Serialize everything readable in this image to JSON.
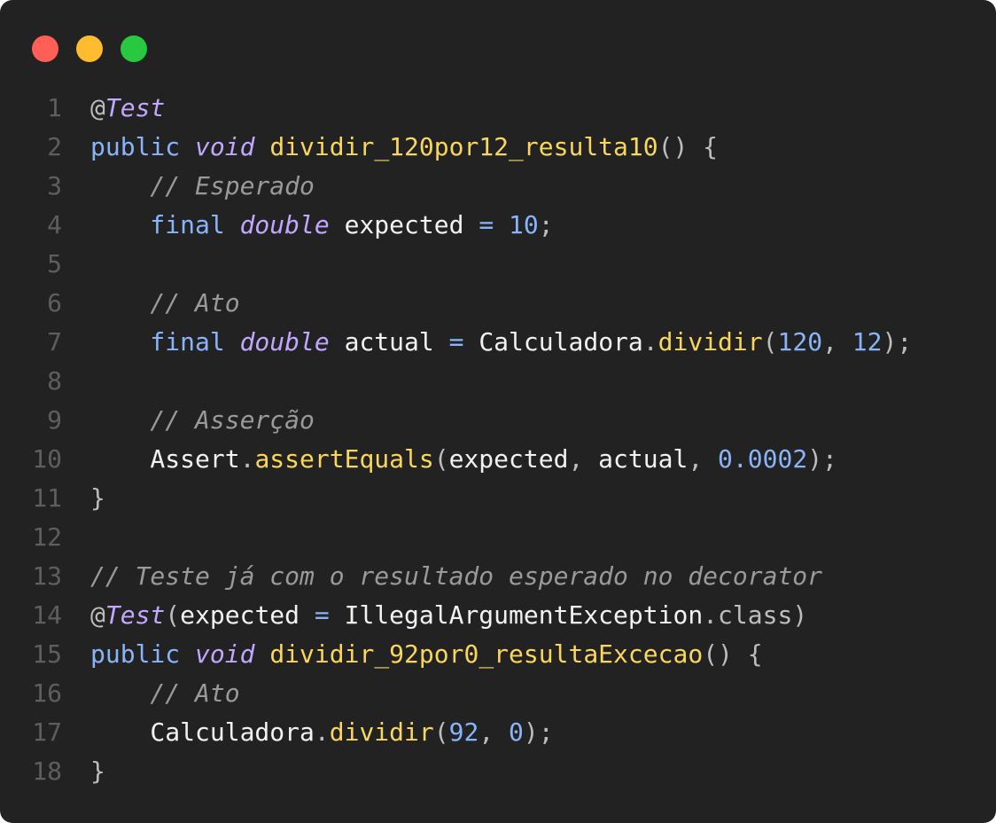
{
  "window": {
    "controls": [
      {
        "name": "close-dot",
        "color": "#ff5f57"
      },
      {
        "name": "minimize-dot",
        "color": "#febc2e"
      },
      {
        "name": "maximize-dot",
        "color": "#28c840"
      }
    ]
  },
  "colors": {
    "background": "#222222",
    "line_number": "#5e5e5e",
    "keyword": "#89b4fa",
    "type_italic": "#c3a6ff",
    "method": "#f9d65c",
    "identifier": "#f2f2f2",
    "number": "#89b4fa",
    "comment": "#9a9a9a",
    "punct": "#bdbdbd",
    "operator": "#89b4fa"
  },
  "code": {
    "lines": [
      {
        "n": "1",
        "tokens": [
          {
            "t": "@",
            "c": "punct"
          },
          {
            "t": "Test",
            "c": "type_italic",
            "i": true
          }
        ]
      },
      {
        "n": "2",
        "tokens": [
          {
            "t": "public ",
            "c": "keyword"
          },
          {
            "t": "void ",
            "c": "type_italic",
            "i": true
          },
          {
            "t": "dividir_120por12_resulta10",
            "c": "method"
          },
          {
            "t": "() {",
            "c": "punct"
          }
        ]
      },
      {
        "n": "3",
        "tokens": [
          {
            "t": "    // Esperado",
            "c": "comment",
            "i": true
          }
        ]
      },
      {
        "n": "4",
        "tokens": [
          {
            "t": "    final ",
            "c": "keyword"
          },
          {
            "t": "double ",
            "c": "type_italic",
            "i": true
          },
          {
            "t": "expected ",
            "c": "identifier"
          },
          {
            "t": "= ",
            "c": "operator"
          },
          {
            "t": "10",
            "c": "number"
          },
          {
            "t": ";",
            "c": "punct"
          }
        ]
      },
      {
        "n": "5",
        "tokens": []
      },
      {
        "n": "6",
        "tokens": [
          {
            "t": "    // Ato",
            "c": "comment",
            "i": true
          }
        ]
      },
      {
        "n": "7",
        "tokens": [
          {
            "t": "    final ",
            "c": "keyword"
          },
          {
            "t": "double ",
            "c": "type_italic",
            "i": true
          },
          {
            "t": "actual ",
            "c": "identifier"
          },
          {
            "t": "= ",
            "c": "operator"
          },
          {
            "t": "Calculadora",
            "c": "identifier"
          },
          {
            "t": ".",
            "c": "punct"
          },
          {
            "t": "dividir",
            "c": "method"
          },
          {
            "t": "(",
            "c": "punct"
          },
          {
            "t": "120",
            "c": "number"
          },
          {
            "t": ", ",
            "c": "punct"
          },
          {
            "t": "12",
            "c": "number"
          },
          {
            "t": ");",
            "c": "punct"
          }
        ]
      },
      {
        "n": "8",
        "tokens": []
      },
      {
        "n": "9",
        "tokens": [
          {
            "t": "    // Asserção",
            "c": "comment",
            "i": true
          }
        ]
      },
      {
        "n": "10",
        "tokens": [
          {
            "t": "    Assert",
            "c": "identifier"
          },
          {
            "t": ".",
            "c": "punct"
          },
          {
            "t": "assertEquals",
            "c": "method"
          },
          {
            "t": "(",
            "c": "punct"
          },
          {
            "t": "expected",
            "c": "identifier"
          },
          {
            "t": ", ",
            "c": "punct"
          },
          {
            "t": "actual",
            "c": "identifier"
          },
          {
            "t": ", ",
            "c": "punct"
          },
          {
            "t": "0.0002",
            "c": "number"
          },
          {
            "t": ");",
            "c": "punct"
          }
        ]
      },
      {
        "n": "11",
        "tokens": [
          {
            "t": "}",
            "c": "punct"
          }
        ]
      },
      {
        "n": "12",
        "tokens": []
      },
      {
        "n": "13",
        "tokens": [
          {
            "t": "// Teste já com o resultado esperado no decorator",
            "c": "comment",
            "i": true
          }
        ]
      },
      {
        "n": "14",
        "tokens": [
          {
            "t": "@",
            "c": "punct"
          },
          {
            "t": "Test",
            "c": "type_italic",
            "i": true
          },
          {
            "t": "(",
            "c": "punct"
          },
          {
            "t": "expected ",
            "c": "identifier"
          },
          {
            "t": "= ",
            "c": "operator"
          },
          {
            "t": "IllegalArgumentException",
            "c": "identifier"
          },
          {
            "t": ".class)",
            "c": "punct"
          }
        ]
      },
      {
        "n": "15",
        "tokens": [
          {
            "t": "public ",
            "c": "keyword"
          },
          {
            "t": "void ",
            "c": "type_italic",
            "i": true
          },
          {
            "t": "dividir_92por0_resultaExcecao",
            "c": "method"
          },
          {
            "t": "() {",
            "c": "punct"
          }
        ]
      },
      {
        "n": "16",
        "tokens": [
          {
            "t": "    // Ato",
            "c": "comment",
            "i": true
          }
        ]
      },
      {
        "n": "17",
        "tokens": [
          {
            "t": "    Calculadora",
            "c": "identifier"
          },
          {
            "t": ".",
            "c": "punct"
          },
          {
            "t": "dividir",
            "c": "method"
          },
          {
            "t": "(",
            "c": "punct"
          },
          {
            "t": "92",
            "c": "number"
          },
          {
            "t": ", ",
            "c": "punct"
          },
          {
            "t": "0",
            "c": "number"
          },
          {
            "t": ");",
            "c": "punct"
          }
        ]
      },
      {
        "n": "18",
        "tokens": [
          {
            "t": "}",
            "c": "punct"
          }
        ]
      }
    ]
  }
}
